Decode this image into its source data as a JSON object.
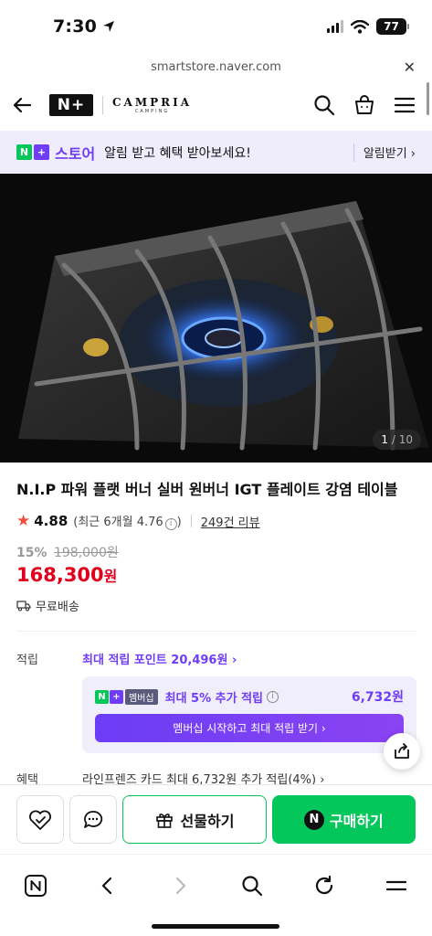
{
  "status": {
    "time": "7:30",
    "battery": "77"
  },
  "browser": {
    "url": "smartstore.naver.com"
  },
  "nav": {
    "nplus": "N+",
    "brand": "CAMPRIA",
    "brand_sub": "CAMPING"
  },
  "promo": {
    "store": "스토어",
    "text": "알림 받고 혜택 받아보세요!",
    "action": "알림받기"
  },
  "gallery": {
    "current": "1",
    "total": "/ 10"
  },
  "product": {
    "title": "N.I.P 파워 플랫 버너 실버 원버너 IGT 플레이트 강염 테이블",
    "rating": "4.88",
    "rating_recent": "(최근 6개월 4.76",
    "rating_recent_close": ")",
    "reviews": "249건 리뷰",
    "discount": "15%",
    "original_price": "198,000원",
    "price": "168,300",
    "price_unit": "원",
    "shipping": "무료배송"
  },
  "points": {
    "label": "적립",
    "link": "최대 적립 포인트 20,496원",
    "member_tag": "멤버십",
    "member_extra": "최대 5% 추가 적립",
    "member_amount": "6,732원",
    "member_button": "멤버십 시작하고 최대 적립 받기"
  },
  "benefit": {
    "label": "혜택",
    "text": "라인프렌즈 카드 최대 6,732원 추가 적립(4%)"
  },
  "actions": {
    "gift": "선물하기",
    "buy": "구매하기"
  },
  "colors": {
    "naver_green": "#03c75a",
    "purple": "#6f3cf7",
    "price_red": "#e0001b"
  }
}
